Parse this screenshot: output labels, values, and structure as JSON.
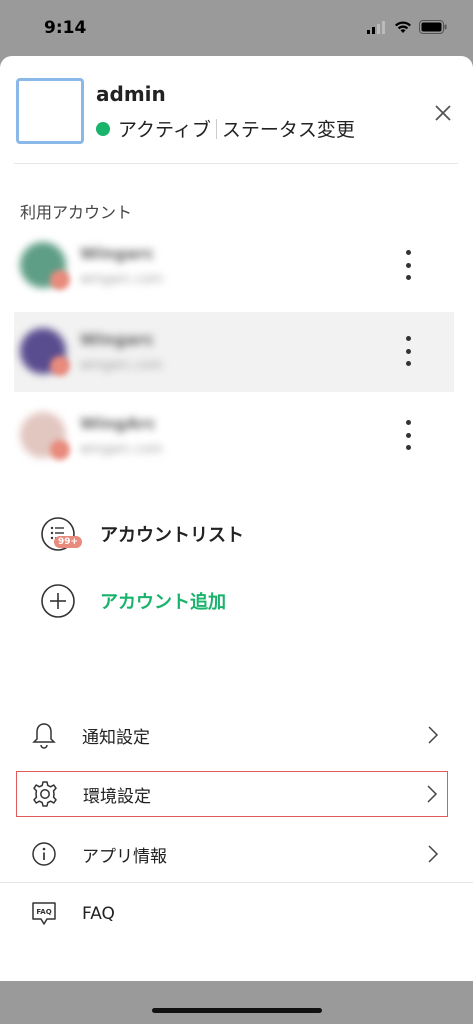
{
  "status_bar": {
    "time": "9:14"
  },
  "header": {
    "user_name": "admin",
    "status_text": "アクティブ",
    "status_change_label": "ステータス変更",
    "status_color": "#19b36b"
  },
  "accounts_section": {
    "label": "利用アカウント",
    "accounts": [
      {
        "name": "Wingarc",
        "email": "wingarc.com",
        "avatar_color": "#5e9e86"
      },
      {
        "name": "Wingarc",
        "email": "wingarc.com",
        "avatar_color": "#5a4d8f"
      },
      {
        "name": "WingArc",
        "email": "wingarc.com",
        "avatar_color": "#d86a5a"
      }
    ]
  },
  "actions": {
    "account_list_label": "アカウントリスト",
    "account_list_badge": "99+",
    "add_account_label": "アカウント追加",
    "accent_color": "#19b36b"
  },
  "menu": {
    "items": [
      {
        "label": "通知設定",
        "icon": "bell-icon"
      },
      {
        "label": "環境設定",
        "icon": "gear-icon"
      },
      {
        "label": "アプリ情報",
        "icon": "info-icon"
      },
      {
        "label": "FAQ",
        "icon": "faq-icon"
      }
    ]
  }
}
